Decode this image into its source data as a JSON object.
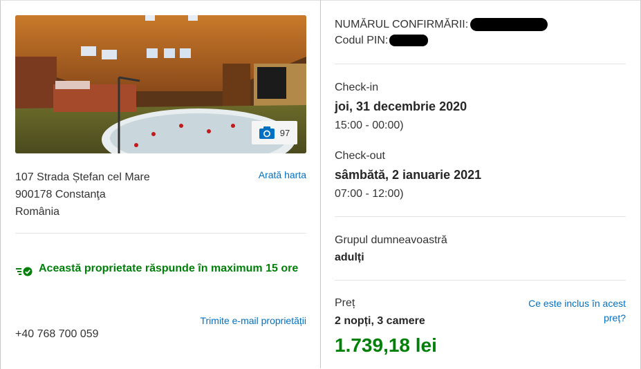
{
  "property": {
    "photo_count": "97",
    "address_lines": [
      "107 Strada Ștefan cel Mare",
      "900178 Constanţa",
      "România"
    ],
    "map_link": "Arată harta",
    "response_text": "Această proprietate răspunde în maximum 15 ore",
    "email_link": "Trimite e-mail proprietății",
    "phone": "+40 768 700 059"
  },
  "booking": {
    "confirmation_label": "NUMĂRUL CONFIRMĂRII:",
    "pin_label": "Codul PIN:",
    "checkin_label": "Check-in",
    "checkin_date": "joi, 31 decembrie 2020",
    "checkin_time": "15:00 - 00:00)",
    "checkout_label": "Check-out",
    "checkout_date": "sâmbătă, 2 ianuarie 2021",
    "checkout_time": "07:00 - 12:00)",
    "group_label": "Grupul dumneavoastră",
    "group_value": "adulți",
    "price_label": "Preț",
    "price_details": "2 nopți, 3 camere",
    "price_link": "Ce este inclus în acest preț?",
    "price_value": "1.739,18 lei"
  },
  "colors": {
    "link": "#0071c2",
    "positive": "#008009"
  },
  "icons": [
    "camera-icon",
    "response-time-check-icon"
  ]
}
